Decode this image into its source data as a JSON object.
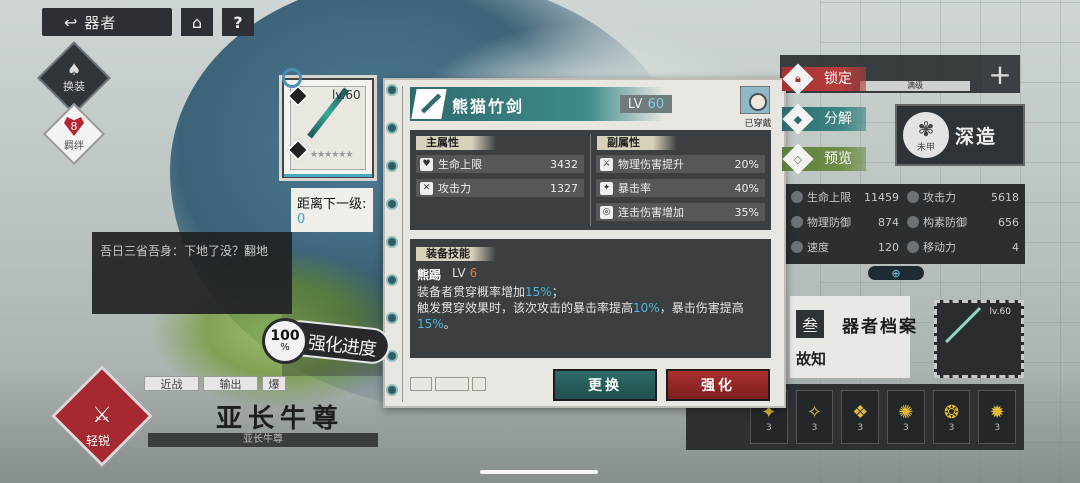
{
  "nav": {
    "back_label": "器者",
    "back_icon": "↩",
    "home_icon": "⌂",
    "help_icon": "?"
  },
  "left_panel": {
    "swap_label": "换装",
    "heart_count": "8",
    "heart_label": "羁绊",
    "quote": "吾日三省吾身：下地了没？翻地",
    "hero": {
      "badge_label": "轻锐",
      "tags": [
        "近战",
        "输出",
        "爆"
      ],
      "name": "亚长牛尊",
      "subtitle": "亚长牛尊"
    }
  },
  "weapon_card": {
    "level": "lv.60",
    "stars": "★★★★★★",
    "next_level_label": "距离下一级:",
    "next_level_value": "0"
  },
  "enhance_progress": {
    "percent": "100",
    "percent_sign": "%",
    "label": "强化进度"
  },
  "dialog": {
    "weapon_name": "熊猫竹剑",
    "level_label": "LV",
    "level_value": "60",
    "owner_label": "已穿戴",
    "main_attr_title": "主属性",
    "sub_attr_title": "副属性",
    "main_attrs": [
      {
        "icon": "heart-icon",
        "glyph": "♥",
        "label": "生命上限",
        "value": "3432"
      },
      {
        "icon": "crossed-swords-icon",
        "glyph": "✕",
        "label": "攻击力",
        "value": "1327"
      }
    ],
    "sub_attrs": [
      {
        "icon": "physical-dmg-icon",
        "glyph": "⚔",
        "label": "物理伤害提升",
        "value": "20%"
      },
      {
        "icon": "crit-icon",
        "glyph": "✦",
        "label": "暴击率",
        "value": "40%"
      },
      {
        "icon": "combo-dmg-icon",
        "glyph": "◎",
        "label": "连击伤害增加",
        "value": "35%"
      }
    ],
    "skill_title": "装备技能",
    "skill_name": "熊踢",
    "skill_level_label": "LV",
    "skill_level_value": "6",
    "skill_desc_1a": "装备者贯穿概率增加",
    "skill_desc_1b": "15%",
    "skill_desc_1c": "；",
    "skill_desc_2a": "触发贯穿效果时，该次攻击的暴击率提高",
    "skill_desc_2b": "10%",
    "skill_desc_2c": "，暴击伤害提高",
    "skill_desc_2d": "15%",
    "skill_desc_2e": "。",
    "btn_change": "更换",
    "btn_enhance": "强化"
  },
  "side_actions": {
    "lock": "锁定",
    "disassemble": "分解",
    "preview": "预览"
  },
  "right_panel": {
    "deep_forge": "深造",
    "deep_icon_label": "未甲",
    "stats": [
      {
        "label": "生命上限",
        "value": "11459"
      },
      {
        "label": "攻击力",
        "value": "5618"
      },
      {
        "label": "物理防御",
        "value": "874"
      },
      {
        "label": "构素防御",
        "value": "656"
      },
      {
        "label": "速度",
        "value": "120"
      },
      {
        "label": "移动力",
        "value": "4"
      }
    ],
    "zoom_icon": "⊕",
    "card_big_char": "叁",
    "card_big_text": "故知",
    "archive": "器者档案",
    "weapon_level": "lv.60",
    "skill_icons": [
      {
        "name": "skill-icon-1",
        "count": "3"
      },
      {
        "name": "skill-icon-2",
        "count": "3"
      },
      {
        "name": "skill-icon-3",
        "count": "3"
      },
      {
        "name": "skill-icon-4",
        "count": "3"
      },
      {
        "name": "skill-icon-5",
        "count": "3"
      },
      {
        "name": "skill-icon-6",
        "count": "3"
      }
    ]
  },
  "colors": {
    "teal": "#2f6b6d",
    "red": "#a53234",
    "highlight_blue": "#4cb6d6",
    "level_orange": "#e87a3a"
  }
}
